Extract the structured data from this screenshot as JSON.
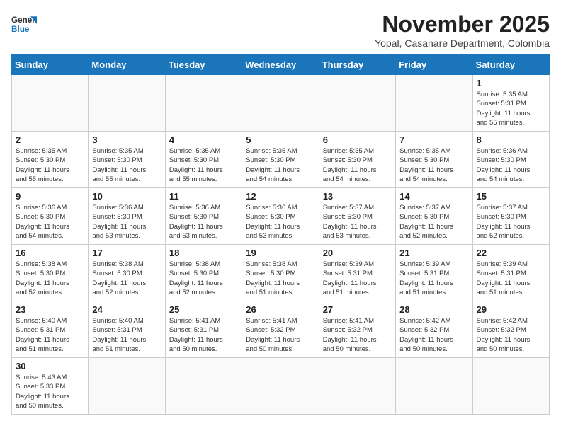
{
  "header": {
    "logo_line1": "General",
    "logo_line2": "Blue",
    "month": "November 2025",
    "location": "Yopal, Casanare Department, Colombia"
  },
  "days_of_week": [
    "Sunday",
    "Monday",
    "Tuesday",
    "Wednesday",
    "Thursday",
    "Friday",
    "Saturday"
  ],
  "weeks": [
    [
      {
        "day": "",
        "info": ""
      },
      {
        "day": "",
        "info": ""
      },
      {
        "day": "",
        "info": ""
      },
      {
        "day": "",
        "info": ""
      },
      {
        "day": "",
        "info": ""
      },
      {
        "day": "",
        "info": ""
      },
      {
        "day": "1",
        "info": "Sunrise: 5:35 AM\nSunset: 5:31 PM\nDaylight: 11 hours\nand 55 minutes."
      }
    ],
    [
      {
        "day": "2",
        "info": "Sunrise: 5:35 AM\nSunset: 5:30 PM\nDaylight: 11 hours\nand 55 minutes."
      },
      {
        "day": "3",
        "info": "Sunrise: 5:35 AM\nSunset: 5:30 PM\nDaylight: 11 hours\nand 55 minutes."
      },
      {
        "day": "4",
        "info": "Sunrise: 5:35 AM\nSunset: 5:30 PM\nDaylight: 11 hours\nand 55 minutes."
      },
      {
        "day": "5",
        "info": "Sunrise: 5:35 AM\nSunset: 5:30 PM\nDaylight: 11 hours\nand 54 minutes."
      },
      {
        "day": "6",
        "info": "Sunrise: 5:35 AM\nSunset: 5:30 PM\nDaylight: 11 hours\nand 54 minutes."
      },
      {
        "day": "7",
        "info": "Sunrise: 5:35 AM\nSunset: 5:30 PM\nDaylight: 11 hours\nand 54 minutes."
      },
      {
        "day": "8",
        "info": "Sunrise: 5:36 AM\nSunset: 5:30 PM\nDaylight: 11 hours\nand 54 minutes."
      }
    ],
    [
      {
        "day": "9",
        "info": "Sunrise: 5:36 AM\nSunset: 5:30 PM\nDaylight: 11 hours\nand 54 minutes."
      },
      {
        "day": "10",
        "info": "Sunrise: 5:36 AM\nSunset: 5:30 PM\nDaylight: 11 hours\nand 53 minutes."
      },
      {
        "day": "11",
        "info": "Sunrise: 5:36 AM\nSunset: 5:30 PM\nDaylight: 11 hours\nand 53 minutes."
      },
      {
        "day": "12",
        "info": "Sunrise: 5:36 AM\nSunset: 5:30 PM\nDaylight: 11 hours\nand 53 minutes."
      },
      {
        "day": "13",
        "info": "Sunrise: 5:37 AM\nSunset: 5:30 PM\nDaylight: 11 hours\nand 53 minutes."
      },
      {
        "day": "14",
        "info": "Sunrise: 5:37 AM\nSunset: 5:30 PM\nDaylight: 11 hours\nand 52 minutes."
      },
      {
        "day": "15",
        "info": "Sunrise: 5:37 AM\nSunset: 5:30 PM\nDaylight: 11 hours\nand 52 minutes."
      }
    ],
    [
      {
        "day": "16",
        "info": "Sunrise: 5:38 AM\nSunset: 5:30 PM\nDaylight: 11 hours\nand 52 minutes."
      },
      {
        "day": "17",
        "info": "Sunrise: 5:38 AM\nSunset: 5:30 PM\nDaylight: 11 hours\nand 52 minutes."
      },
      {
        "day": "18",
        "info": "Sunrise: 5:38 AM\nSunset: 5:30 PM\nDaylight: 11 hours\nand 52 minutes."
      },
      {
        "day": "19",
        "info": "Sunrise: 5:38 AM\nSunset: 5:30 PM\nDaylight: 11 hours\nand 51 minutes."
      },
      {
        "day": "20",
        "info": "Sunrise: 5:39 AM\nSunset: 5:31 PM\nDaylight: 11 hours\nand 51 minutes."
      },
      {
        "day": "21",
        "info": "Sunrise: 5:39 AM\nSunset: 5:31 PM\nDaylight: 11 hours\nand 51 minutes."
      },
      {
        "day": "22",
        "info": "Sunrise: 5:39 AM\nSunset: 5:31 PM\nDaylight: 11 hours\nand 51 minutes."
      }
    ],
    [
      {
        "day": "23",
        "info": "Sunrise: 5:40 AM\nSunset: 5:31 PM\nDaylight: 11 hours\nand 51 minutes."
      },
      {
        "day": "24",
        "info": "Sunrise: 5:40 AM\nSunset: 5:31 PM\nDaylight: 11 hours\nand 51 minutes."
      },
      {
        "day": "25",
        "info": "Sunrise: 5:41 AM\nSunset: 5:31 PM\nDaylight: 11 hours\nand 50 minutes."
      },
      {
        "day": "26",
        "info": "Sunrise: 5:41 AM\nSunset: 5:32 PM\nDaylight: 11 hours\nand 50 minutes."
      },
      {
        "day": "27",
        "info": "Sunrise: 5:41 AM\nSunset: 5:32 PM\nDaylight: 11 hours\nand 50 minutes."
      },
      {
        "day": "28",
        "info": "Sunrise: 5:42 AM\nSunset: 5:32 PM\nDaylight: 11 hours\nand 50 minutes."
      },
      {
        "day": "29",
        "info": "Sunrise: 5:42 AM\nSunset: 5:32 PM\nDaylight: 11 hours\nand 50 minutes."
      }
    ],
    [
      {
        "day": "30",
        "info": "Sunrise: 5:43 AM\nSunset: 5:33 PM\nDaylight: 11 hours\nand 50 minutes."
      },
      {
        "day": "",
        "info": ""
      },
      {
        "day": "",
        "info": ""
      },
      {
        "day": "",
        "info": ""
      },
      {
        "day": "",
        "info": ""
      },
      {
        "day": "",
        "info": ""
      },
      {
        "day": "",
        "info": ""
      }
    ]
  ]
}
